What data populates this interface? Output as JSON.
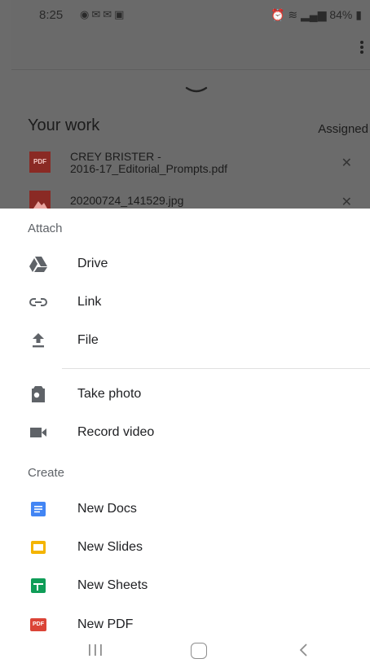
{
  "status_bar": {
    "time": "8:25",
    "left_icons": [
      "messenger-icon",
      "mail-icon",
      "mail-icon",
      "image-icon"
    ],
    "right_icons": [
      "alarm-icon",
      "wifi-icon",
      "signal-icon"
    ],
    "battery": "84%"
  },
  "background": {
    "section_title": "Your work",
    "status": "Assigned",
    "attachments": [
      {
        "type": "pdf",
        "thumb_label": "PDF",
        "line1": "CREY BRISTER -",
        "line2": "2016-17_Editorial_Prompts.pdf"
      },
      {
        "type": "image",
        "line1": "20200724_141529.jpg"
      }
    ],
    "remove_glyph": "✕"
  },
  "sheet": {
    "attach_label": "Attach",
    "attach_items": [
      {
        "icon": "drive-icon",
        "label": "Drive"
      },
      {
        "icon": "link-icon",
        "label": "Link"
      },
      {
        "icon": "upload-file-icon",
        "label": "File"
      }
    ],
    "media_items": [
      {
        "icon": "camera-icon",
        "label": "Take photo"
      },
      {
        "icon": "video-camera-icon",
        "label": "Record video"
      }
    ],
    "create_label": "Create",
    "create_items": [
      {
        "icon": "docs-icon",
        "label": "New Docs"
      },
      {
        "icon": "slides-icon",
        "label": "New Slides"
      },
      {
        "icon": "sheets-icon",
        "label": "New Sheets"
      },
      {
        "icon": "pdf-icon",
        "label": "New PDF",
        "badge": "PDF"
      }
    ]
  },
  "colors": {
    "docs": "#4285f4",
    "slides": "#f4b400",
    "sheets": "#0f9d58",
    "pdf": "#db4437",
    "icon_gray": "#5f6368"
  },
  "nav_bar": [
    "recents-icon",
    "home-icon",
    "back-icon"
  ]
}
